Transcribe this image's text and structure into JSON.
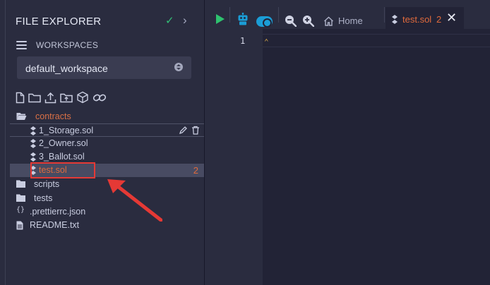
{
  "explorer": {
    "title": "FILE EXPLORER",
    "workspaces_label": "WORKSPACES",
    "workspace_selected": "default_workspace"
  },
  "tree": [
    {
      "label": "contracts",
      "type": "folder-open",
      "icon": "folder-open-icon"
    },
    {
      "label": "1_Storage.sol",
      "type": "sol-file",
      "icon": "solidity-icon"
    },
    {
      "label": "2_Owner.sol",
      "type": "sol-file",
      "icon": "solidity-icon"
    },
    {
      "label": "3_Ballot.sol",
      "type": "sol-file",
      "icon": "solidity-icon"
    },
    {
      "label": "test.sol",
      "type": "sol-file",
      "icon": "solidity-icon",
      "problems": "2"
    },
    {
      "label": "scripts",
      "type": "folder",
      "icon": "folder-icon"
    },
    {
      "label": "tests",
      "type": "folder",
      "icon": "folder-icon"
    },
    {
      "label": ".prettierrc.json",
      "type": "json-file",
      "icon": "braces-icon"
    },
    {
      "label": "README.txt",
      "type": "text-file",
      "icon": "file-text-icon"
    }
  ],
  "editor": {
    "home_tab": "Home",
    "active_tab": "test.sol",
    "active_tab_problems": "2",
    "line_numbers": [
      "1"
    ]
  },
  "colors": {
    "accent_orange": "#e06a3c",
    "check_green": "#33bf77",
    "toggle_blue": "#1b9dd6",
    "annotation_red": "#e53935"
  }
}
